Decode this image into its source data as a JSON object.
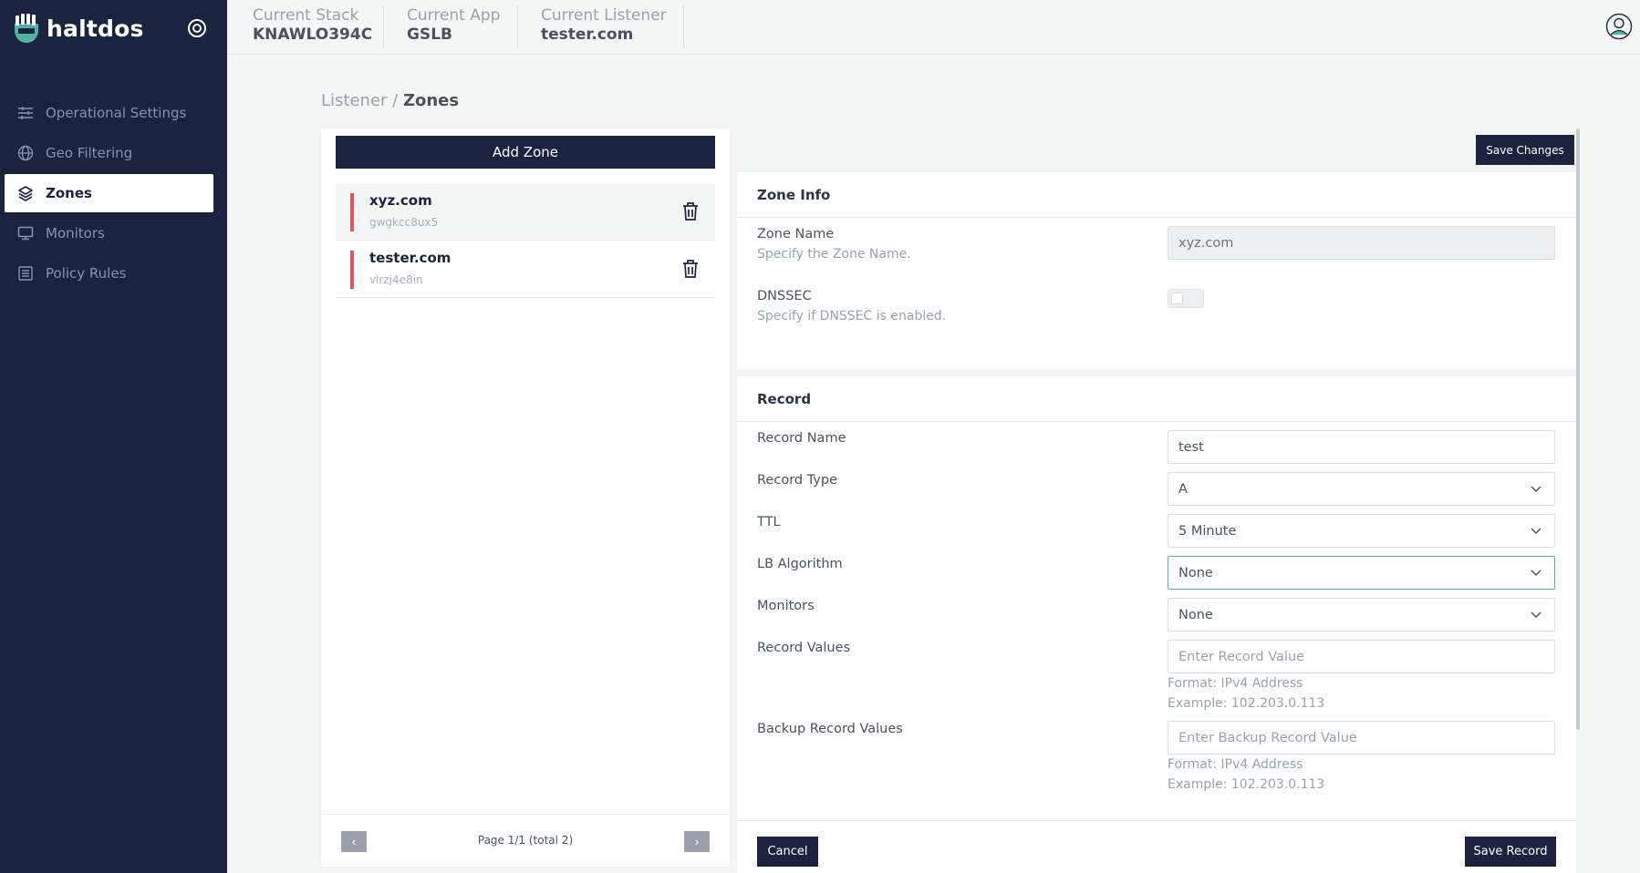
{
  "brand": {
    "name": "haltdos"
  },
  "sidebar": {
    "items": [
      {
        "label": "Operational Settings",
        "icon": "sliders-icon",
        "active": false
      },
      {
        "label": "Geo Filtering",
        "icon": "globe-icon",
        "active": false
      },
      {
        "label": "Zones",
        "icon": "layers-icon",
        "active": true
      },
      {
        "label": "Monitors",
        "icon": "monitor-icon",
        "active": false
      },
      {
        "label": "Policy Rules",
        "icon": "list-icon",
        "active": false
      }
    ]
  },
  "context": {
    "stack_label": "Current Stack",
    "stack_value": "KNAWLO394C",
    "app_label": "Current App",
    "app_value": "GSLB",
    "listener_label": "Current Listener",
    "listener_value": "tester.com"
  },
  "breadcrumb": {
    "parent": "Listener",
    "separator": " / ",
    "current": "Zones"
  },
  "zones": {
    "add_label": "Add Zone",
    "items": [
      {
        "name": "xyz.com",
        "id": "gwgkcc8ux5",
        "selected": true
      },
      {
        "name": "tester.com",
        "id": "vlrzj4e8in",
        "selected": false
      }
    ],
    "pager": {
      "text": "Page 1/1 (total 2)",
      "prev": "‹",
      "next": "›"
    }
  },
  "actions": {
    "save_changes": "Save Changes",
    "cancel": "Cancel",
    "save_record": "Save Record"
  },
  "zone_info": {
    "title": "Zone Info",
    "zone_name_label": "Zone Name",
    "zone_name_help": "Specify the Zone Name.",
    "zone_name_value": "xyz.com",
    "dnssec_label": "DNSSEC",
    "dnssec_help": "Specify if DNSSEC is enabled.",
    "dnssec_enabled": false
  },
  "record": {
    "title": "Record",
    "name_label": "Record Name",
    "name_value": "test",
    "type_label": "Record Type",
    "type_value": "A",
    "ttl_label": "TTL",
    "ttl_value": "5 Minute",
    "lb_label": "LB Algorithm",
    "lb_value": "None",
    "monitors_label": "Monitors",
    "monitors_value": "None",
    "values_label": "Record Values",
    "values_placeholder": "Enter Record Value",
    "values_format": "Format: IPv4 Address",
    "values_example": "Example: 102.203.0.113",
    "backup_label": "Backup Record Values",
    "backup_placeholder": "Enter Backup Record Value",
    "backup_format": "Format: IPv4 Address",
    "backup_example": "Example: 102.203.0.113"
  },
  "colors": {
    "sidebar_bg": "#1c2340",
    "accent": "#1c2340",
    "zone_marker": "#e8535a",
    "focus": "#4fb3a4"
  }
}
